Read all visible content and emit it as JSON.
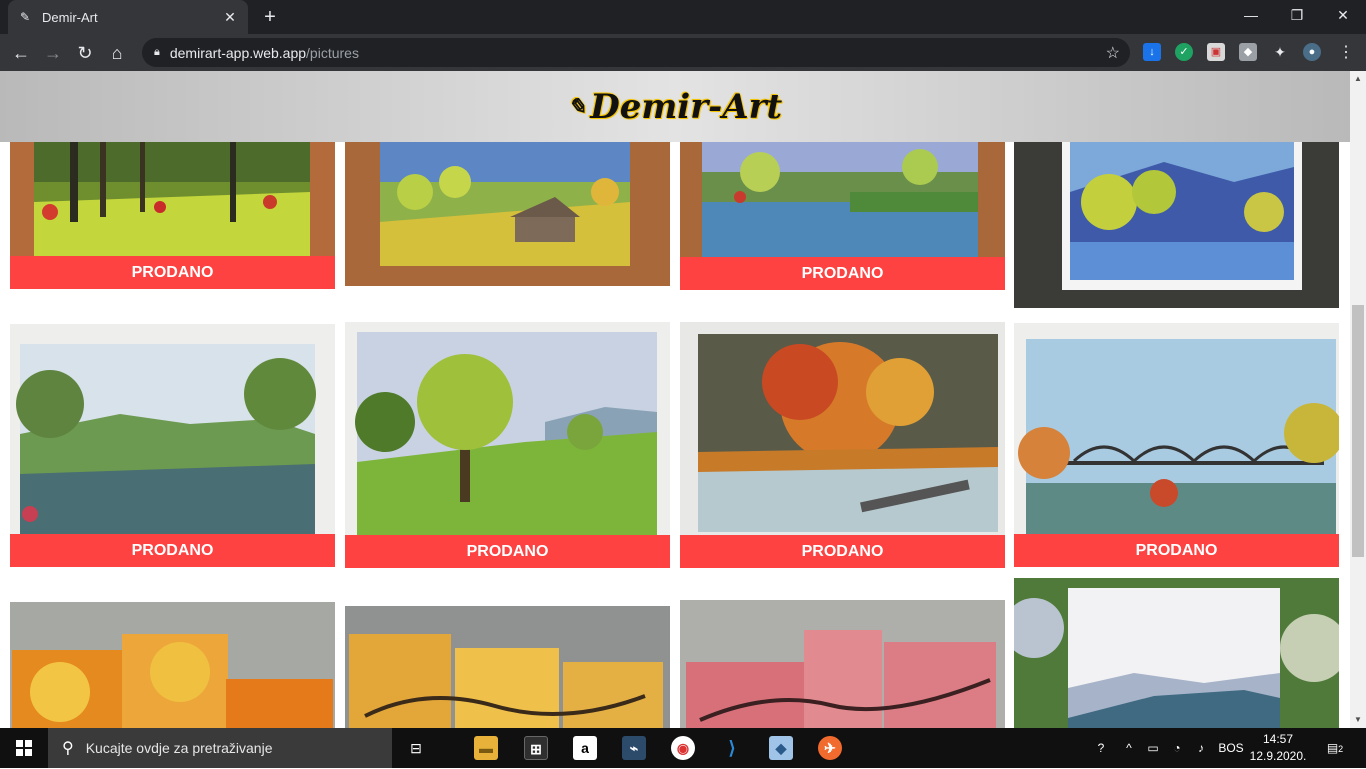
{
  "browser": {
    "tab_title": "Demir-Art",
    "tab_close": "✕",
    "new_tab": "+",
    "url_host": "demirart-app.web.app",
    "url_path": "/pictures",
    "window_controls": [
      "—",
      "❐",
      "✕"
    ]
  },
  "site": {
    "logo_text": "Demir-Art"
  },
  "gallery": {
    "sold_label": "PRODANO",
    "items": [
      {
        "row": 1,
        "col": 1,
        "sold": true,
        "subject": "forest"
      },
      {
        "row": 1,
        "col": 2,
        "sold": false,
        "subject": "cabin"
      },
      {
        "row": 1,
        "col": 3,
        "sold": true,
        "subject": "river"
      },
      {
        "row": 1,
        "col": 4,
        "sold": false,
        "subject": "mountain-lake"
      },
      {
        "row": 2,
        "col": 1,
        "sold": true,
        "subject": "valley-river"
      },
      {
        "row": 2,
        "col": 2,
        "sold": true,
        "subject": "meadow-tree"
      },
      {
        "row": 2,
        "col": 3,
        "sold": true,
        "subject": "autumn-river"
      },
      {
        "row": 2,
        "col": 4,
        "sold": true,
        "subject": "bridge"
      },
      {
        "row": 3,
        "col": 1,
        "sold": false,
        "subject": "orange-triptych"
      },
      {
        "row": 3,
        "col": 2,
        "sold": false,
        "subject": "yellow-triptych"
      },
      {
        "row": 3,
        "col": 3,
        "sold": false,
        "subject": "pink-triptych"
      },
      {
        "row": 3,
        "col": 4,
        "sold": false,
        "subject": "misty-hills"
      }
    ]
  },
  "taskbar": {
    "search_placeholder": "Kucajte ovdje za pretraživanje",
    "language": "BOS",
    "time": "14:57",
    "date": "12.9.2020.",
    "notification_count": "2"
  }
}
